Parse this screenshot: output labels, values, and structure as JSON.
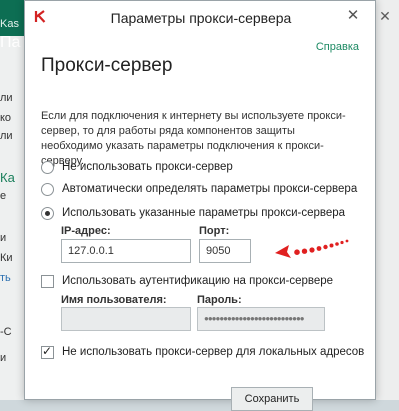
{
  "background": {
    "title_fragment": "Kas",
    "title_fragment_2": "Па",
    "left_fragments": [
      "ли",
      "ко",
      "ли",
      "Ка",
      "е",
      "и",
      "Ки",
      "ть",
      "-С",
      "и"
    ],
    "close_glyph": "✕"
  },
  "dialog": {
    "title": "Параметры прокси-сервера",
    "close_glyph": "✕",
    "help_link": "Справка",
    "heading": "Прокси-сервер",
    "description": "Если для подключения к интернету вы используете прокси-сервер, то для работы ряда компонентов защиты необходимо указать параметры подключения к прокси-серверу.",
    "radio_options": [
      {
        "label": "Не использовать прокси-сервер",
        "checked": false
      },
      {
        "label": "Автоматически определять параметры прокси-сервера",
        "checked": false
      },
      {
        "label": "Использовать указанные параметры прокси-сервера",
        "checked": true
      }
    ],
    "ip_label": "IP-адрес:",
    "ip_value": "127.0.0.1",
    "port_label": "Порт:",
    "port_value": "9050",
    "auth_checkbox": {
      "label": "Использовать аутентификацию на прокси-сервере",
      "checked": false
    },
    "username_label": "Имя пользователя:",
    "username_value": "",
    "password_label": "Пароль:",
    "password_value": "●●●●●●●●●●●●●●●●●●●●●●●●●●",
    "local_checkbox": {
      "label": "Не использовать прокси-сервер для локальных адресов",
      "checked": true
    },
    "save_button": "Сохранить"
  },
  "colors": {
    "brand_green": "#0d6e53",
    "link_green": "#1c8a63",
    "annotation_red": "#e02020"
  }
}
